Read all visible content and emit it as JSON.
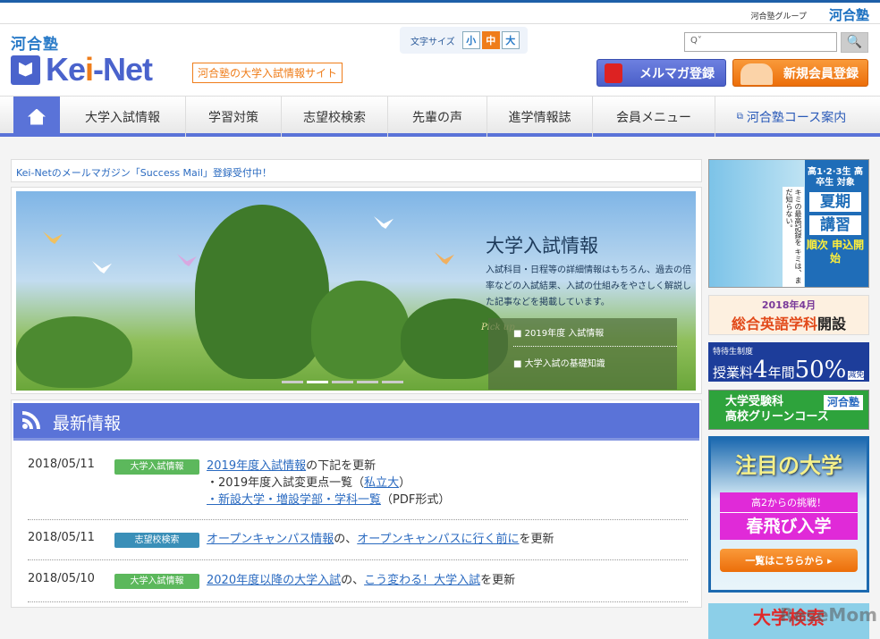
{
  "group": {
    "label": "河合塾グループ",
    "brand": "河合塾"
  },
  "header": {
    "logo_kawai": "河合塾",
    "logo_text_a": "Ke",
    "logo_text_i": "i",
    "logo_text_b": "-Net",
    "tagline": "河合塾の大学入試情報サイト",
    "font_size": {
      "label": "文字サイズ",
      "small": "小",
      "medium": "中",
      "large": "大",
      "selected": "中"
    },
    "search": {
      "placeholder": "Q˅",
      "button": "🔍"
    },
    "mail_button": "メルマガ登録",
    "register_button": "新規会員登録"
  },
  "nav": {
    "items": [
      "大学入試情報",
      "学習対策",
      "志望校検索",
      "先輩の声",
      "進学情報誌",
      "会員メニュー",
      "河合塾コース案内"
    ]
  },
  "notice": "Kei-Netのメールマガジン「Success Mail」登録受付中！",
  "hero": {
    "title": "大学入試情報",
    "desc": "入試科目・日程等の詳細情報はもちろん、過去の倍率などの入試結果、入試の仕組みをやさしく解説した記事などを掲載しています。",
    "pickup_label": "Pick up",
    "links": [
      "■ 2019年度 入試情報",
      "■ 大学入試の基礎知識"
    ]
  },
  "news": {
    "title": "最新情報",
    "rows": [
      {
        "date": "2018/05/11",
        "tag": "大学入試情報",
        "tag_color": "#5cb85c",
        "link1": "2019年度入試情報",
        "text1": "の下記を更新",
        "line2": "・2019年度入試変更点一覧（",
        "link2": "私立大",
        "line2_end": "）",
        "link3": "・新設大学・増設学部・学科一覧",
        "line3_end": "（PDF形式）"
      },
      {
        "date": "2018/05/11",
        "tag": "志望校検索",
        "tag_color": "#3a8fb8",
        "link1": "オープンキャンパス情報",
        "text1": "の、",
        "link2": "オープンキャンパスに行く前に",
        "text2": "を更新"
      },
      {
        "date": "2018/05/10",
        "tag": "大学入試情報",
        "tag_color": "#5cb85c",
        "link1": "2020年度以降の大学入試",
        "text1": "の、",
        "link2": "こう変わる！大学入試",
        "text2": "を更新"
      }
    ]
  },
  "ads": {
    "a1": {
      "target": "高1·2·3生 高卒生 対象",
      "title1": "夏期",
      "title2": "講習",
      "status": "順次 申込開始",
      "copy": "キミの最高記録を キミは、まだ知らない。"
    },
    "a2": {
      "date": "2018年4月",
      "name": "総合英語学科",
      "suffix": "開設"
    },
    "a3": {
      "small": "特待生制度",
      "pre": "授業料",
      "num": "4",
      "mid": "年間",
      "pct": "50%",
      "end": "減免"
    },
    "a4": {
      "l1": "大学受験科",
      "l2": "高校グリーンコース",
      "brand": "河合塾"
    },
    "a5": {
      "title": "注目の大学",
      "sub": "高2からの挑戦！",
      "main": "春飛び入学",
      "button": "一覧はこちらから ▸"
    },
    "a6": {
      "title": "大学検索"
    }
  },
  "watermark": "ReseMom"
}
